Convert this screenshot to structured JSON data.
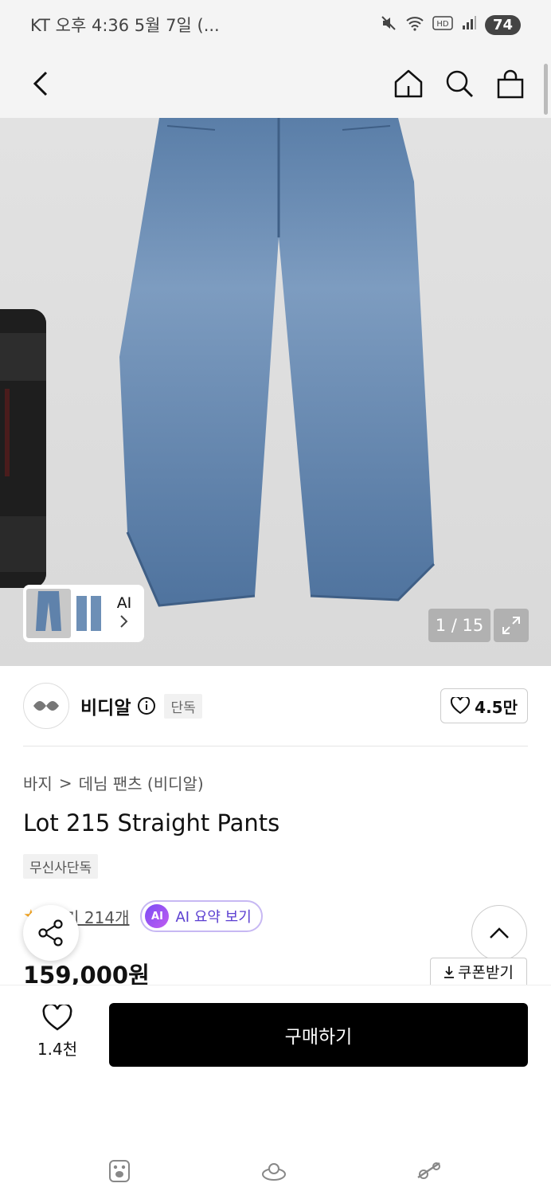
{
  "status_bar": {
    "left_text": "KT 오후 4:36  5월 7일 (...",
    "battery": "74"
  },
  "app_bar": {
    "icons": [
      "back-icon",
      "home-icon",
      "search-icon",
      "cart-icon"
    ]
  },
  "hero": {
    "ai_label": "AI",
    "counter": "1 / 15"
  },
  "brand": {
    "name": "비디알",
    "tag": "단독",
    "likes": "4.5만"
  },
  "breadcrumb": {
    "category": "바지",
    "separator": ">",
    "subcategory": "데님 팬츠 (비디알)"
  },
  "product": {
    "title": "Lot 215 Straight Pants",
    "badge": "무신사단독",
    "reviews": "후기 214개",
    "ai_badge": "AI",
    "ai_summary": "AI 요약 보기",
    "price": "159,000원",
    "coupon": "쿠폰받기"
  },
  "bottom_bar": {
    "wish_count": "1.4천",
    "buy_label": "구매하기"
  },
  "colors": {
    "buy_button": "#000000",
    "ai_accent": "#5b3fd1",
    "star": "#f5a623"
  }
}
